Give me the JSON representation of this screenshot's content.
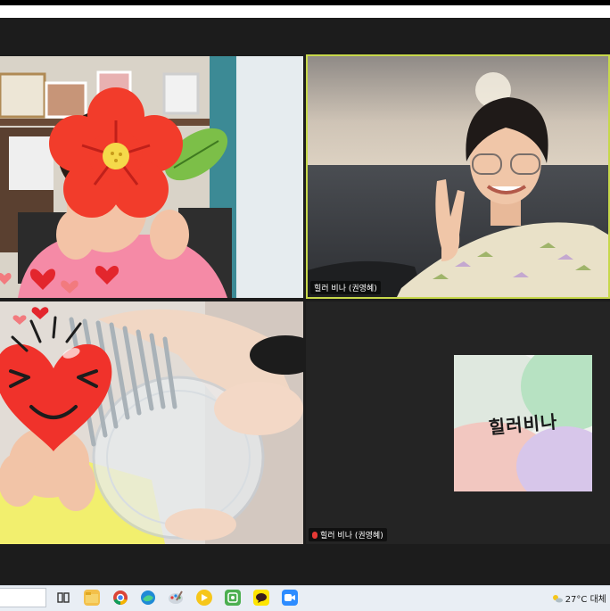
{
  "meeting": {
    "participants": [
      {
        "id": "p1"
      },
      {
        "id": "p2",
        "name": "힐러 비나 (권영혜)"
      },
      {
        "id": "p3"
      },
      {
        "id": "p4",
        "name": "힐러 비나 (권영혜)",
        "avatar_text": "힐러비나"
      }
    ]
  },
  "taskbar": {
    "icons": [
      "task-view-icon",
      "file-explorer-icon",
      "chrome-icon",
      "edge-icon",
      "paint-icon",
      "media-player-icon",
      "tablet-icon",
      "kakaotalk-icon",
      "zoom-icon"
    ],
    "weather": "27°C",
    "weather_desc": "대체"
  },
  "colors": {
    "active_speaker_border": "#c7d84a",
    "taskbar_bg": "#e9eef4"
  }
}
